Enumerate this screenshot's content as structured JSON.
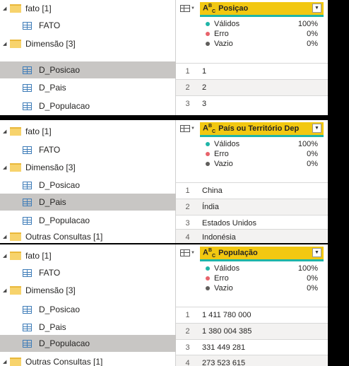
{
  "colors": {
    "header_bg": "#f2c811",
    "valid": "#1fb5a8",
    "error": "#e8636b",
    "empty": "#605e5c",
    "selected_row": "#c8c6c4"
  },
  "panels": [
    {
      "nav": [
        {
          "label": "fato [1]",
          "type": "group"
        },
        {
          "label": "FATO",
          "type": "table"
        },
        {
          "label": "Dimensão [3]",
          "type": "group"
        },
        {
          "label": "D_Posicao",
          "type": "table",
          "selected": true
        },
        {
          "label": "D_Pais",
          "type": "table"
        },
        {
          "label": "D_Populacao",
          "type": "table"
        }
      ],
      "column": {
        "type_icon": "ABC",
        "name": "Posiçao",
        "quality": [
          {
            "label": "Válidos",
            "value": "100%"
          },
          {
            "label": "Erro",
            "value": "0%"
          },
          {
            "label": "Vazio",
            "value": "0%"
          }
        ]
      },
      "rows": [
        {
          "n": "1",
          "v": "1"
        },
        {
          "n": "2",
          "v": "2"
        },
        {
          "n": "3",
          "v": "3"
        }
      ]
    },
    {
      "nav": [
        {
          "label": "fato [1]",
          "type": "group"
        },
        {
          "label": "FATO",
          "type": "table"
        },
        {
          "label": "Dimensão [3]",
          "type": "group"
        },
        {
          "label": "D_Posicao",
          "type": "table"
        },
        {
          "label": "D_Pais",
          "type": "table",
          "selected": true
        },
        {
          "label": "D_Populacao",
          "type": "table"
        },
        {
          "label": "Outras Consultas [1]",
          "type": "group"
        }
      ],
      "column": {
        "type_icon": "ABC",
        "name": "País ou Território Dep",
        "quality": [
          {
            "label": "Válidos",
            "value": "100%"
          },
          {
            "label": "Erro",
            "value": "0%"
          },
          {
            "label": "Vazio",
            "value": "0%"
          }
        ]
      },
      "rows": [
        {
          "n": "1",
          "v": "China"
        },
        {
          "n": "2",
          "v": "Índia"
        },
        {
          "n": "3",
          "v": "Estados Unidos"
        },
        {
          "n": "4",
          "v": "Indonésia"
        }
      ]
    },
    {
      "nav": [
        {
          "label": "fato [1]",
          "type": "group"
        },
        {
          "label": "FATO",
          "type": "table"
        },
        {
          "label": "Dimensão [3]",
          "type": "group"
        },
        {
          "label": "D_Posicao",
          "type": "table"
        },
        {
          "label": "D_Pais",
          "type": "table"
        },
        {
          "label": "D_Populacao",
          "type": "table",
          "selected": true
        },
        {
          "label": "Outras Consultas [1]",
          "type": "group"
        }
      ],
      "column": {
        "type_icon": "ABC",
        "name": "População",
        "quality": [
          {
            "label": "Válidos",
            "value": "100%"
          },
          {
            "label": "Erro",
            "value": "0%"
          },
          {
            "label": "Vazio",
            "value": "0%"
          }
        ]
      },
      "rows": [
        {
          "n": "1",
          "v": "1 411 780 000"
        },
        {
          "n": "2",
          "v": "1 380 004 385"
        },
        {
          "n": "3",
          "v": "331 449 281"
        },
        {
          "n": "4",
          "v": "273 523 615"
        }
      ]
    }
  ]
}
